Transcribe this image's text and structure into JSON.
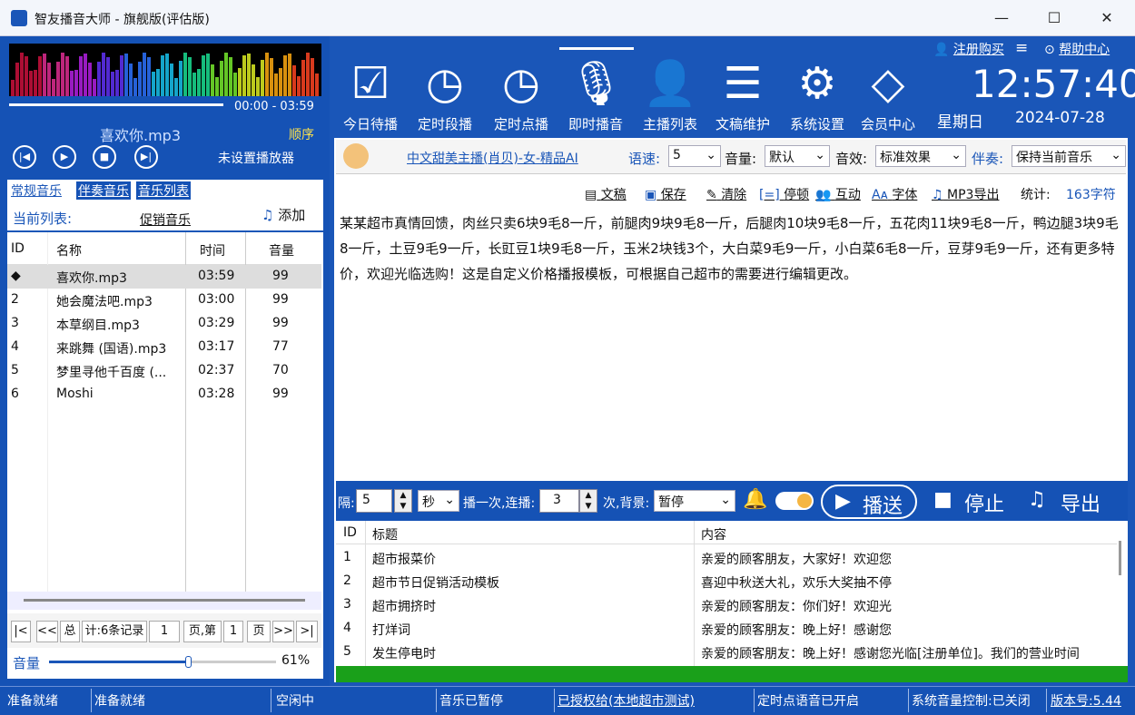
{
  "window": {
    "title": "智友播音大师 - 旗舰版(评估版)"
  },
  "player": {
    "time": "00:00 - 03:59",
    "song": "喜欢你.mp3",
    "order": "顺序",
    "no_player": "未设置播放器",
    "volume_label": "音量",
    "volume_pct": "61%",
    "volume_value": 0.61
  },
  "left_tabs": [
    "常规音乐",
    "伴奏音乐",
    "音乐列表"
  ],
  "current_list": {
    "label": "当前列表:",
    "name": "促销音乐",
    "add": "添加"
  },
  "music_table": {
    "headers": [
      "ID",
      "名称",
      "时间",
      "音量"
    ],
    "rows": [
      [
        "◆",
        "喜欢你.mp3",
        "03:59",
        "99"
      ],
      [
        "2",
        "她会魔法吧.mp3",
        "03:00",
        "99"
      ],
      [
        "3",
        "本草纲目.mp3",
        "03:29",
        "99"
      ],
      [
        "4",
        "来跳舞 (国语).mp3",
        "03:17",
        "77"
      ],
      [
        "5",
        "梦里寻他千百度 (...",
        "02:37",
        "70"
      ],
      [
        "6",
        "Moshi",
        "03:28",
        "99"
      ]
    ]
  },
  "pager": {
    "first": "|<",
    "prev": "<<",
    "total_a": "总",
    "total_b": "计:6条记录",
    "page1": "1",
    "page_word": "页,第",
    "page2": "1",
    "page_end": "页",
    "next": ">>",
    "last": ">|"
  },
  "toolbar": [
    {
      "label": "今日待播",
      "icon": "checklist-icon"
    },
    {
      "label": "定时段播",
      "icon": "clock-icon"
    },
    {
      "label": "定时点播",
      "icon": "clock-icon"
    },
    {
      "label": "即时播音",
      "icon": "microphone-icon"
    },
    {
      "label": "主播列表",
      "icon": "person-icon"
    },
    {
      "label": "文稿维护",
      "icon": "document-icon"
    },
    {
      "label": "系统设置",
      "icon": "gear-icon"
    },
    {
      "label": "会员中心",
      "icon": "diamond-icon"
    }
  ],
  "top_links": {
    "register": "注册购买",
    "help": "帮助中心"
  },
  "clock": {
    "time": "12:57:40",
    "weekday": "星期日",
    "date": "2024-07-28"
  },
  "voice_bar": {
    "anchor": "中文甜美主播(肖贝)-女-精品AI",
    "speed_label": "语速:",
    "speed": "5",
    "volume_label": "音量:",
    "volume": "默认",
    "effect_label": "音效:",
    "effect": "标准效果",
    "accomp_label": "伴奏:",
    "accomp": "保持当前音乐"
  },
  "editor_tools": {
    "doc": "文稿",
    "save": "保存",
    "clear": "清除",
    "pause": "停顿",
    "interact": "互动",
    "font": "字体",
    "mp3": "MP3导出",
    "stats_label": "统计:",
    "stats": "163字符"
  },
  "editor_text": "某某超市真情回馈，肉丝只卖6块9毛8一斤，前腿肉9块9毛8一斤，后腿肉10块9毛8一斤，五花肉11块9毛8一斤，鸭边腿3块9毛8一斤，土豆9毛9一斤，长豇豆1块9毛8一斤，玉米2块钱3个，大白菜9毛9一斤，小白菜6毛8一斤，豆芽9毛9一斤，还有更多特价，欢迎光临选购！这是自定义价格播报模板，可根据自己超市的需要进行编辑更改。",
  "play_bar": {
    "interval_label": "隔:",
    "interval": "5",
    "unit": "秒",
    "once_label": "播一次,连播:",
    "repeat": "3",
    "times_label": "次,背景:",
    "background": "暂停",
    "play": "播送",
    "stop": "停止",
    "export": "导出"
  },
  "program_table": {
    "headers": [
      "ID",
      "标题",
      "内容"
    ],
    "rows": [
      [
        "1",
        "超市报菜价",
        "亲爱的顾客朋友，大家好！欢迎您"
      ],
      [
        "2",
        "超市节日促销活动模板",
        "喜迎中秋送大礼，欢乐大奖抽不停"
      ],
      [
        "3",
        "超市拥挤时",
        "亲爱的顾客朋友：你们好！欢迎光"
      ],
      [
        "4",
        "打烊词",
        "亲爱的顾客朋友：晚上好！感谢您"
      ],
      [
        "5",
        "发生停电时",
        "亲爱的顾客朋友：晚上好！感谢您光临[注册单位]。我们的营业时间"
      ]
    ]
  },
  "status": [
    "准备就绪",
    "准备就绪",
    "空闲中",
    "音乐已暂停",
    "已授权给(本地超市测试)",
    "定时点语音已开启",
    "系统音量控制:已关闭",
    "版本号:5.44"
  ]
}
